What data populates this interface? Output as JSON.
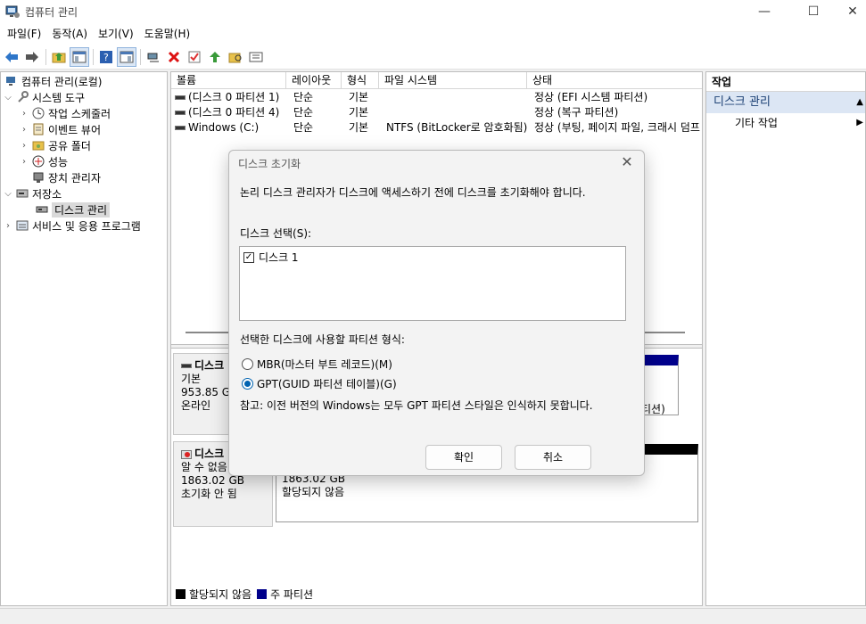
{
  "window": {
    "title": "컴퓨터 관리",
    "minimize": "—",
    "maximize": "☐",
    "close": "✕"
  },
  "menu": [
    "파일(F)",
    "동작(A)",
    "보기(V)",
    "도움말(H)"
  ],
  "toolbar": {
    "icons": [
      "back-arrow-icon",
      "forward-arrow-icon",
      "up-folder-icon",
      "show-pane-icon",
      "help-icon",
      "properties-pane-icon",
      "connect-icon",
      "delete-icon",
      "check-icon",
      "up-arrow-icon",
      "search-folder-icon",
      "list-icon"
    ]
  },
  "tree": {
    "root": "컴퓨터 관리(로컬)",
    "system_tools": "시스템 도구",
    "task_scheduler": "작업 스케줄러",
    "event_viewer": "이벤트 뷰어",
    "shared_folders": "공유 폴더",
    "performance": "성능",
    "device_manager": "장치 관리자",
    "storage": "저장소",
    "disk_management": "디스크 관리",
    "services_apps": "서비스 및 응용 프로그램"
  },
  "volumes": {
    "headers": [
      "볼륨",
      "레이아웃",
      "형식",
      "파일 시스템",
      "상태"
    ],
    "rows": [
      {
        "name": "(디스크 0 파티션 1)",
        "layout": "단순",
        "type": "기본",
        "fs": "",
        "status": "정상 (EFI 시스템 파티션)"
      },
      {
        "name": "(디스크 0 파티션 4)",
        "layout": "단순",
        "type": "기본",
        "fs": "",
        "status": "정상 (복구 파티션)"
      },
      {
        "name": "Windows (C:)",
        "layout": "단순",
        "type": "기본",
        "fs": "NTFS (BitLocker로 암호화됨)",
        "status": "정상 (부팅, 페이지 파일, 크래시 덤프"
      }
    ]
  },
  "disks": {
    "disk0": {
      "name": "디스크",
      "type": "기본",
      "size": "953.85 GB",
      "state": "온라인",
      "partial_status": "티션)"
    },
    "disk1": {
      "name": "디스크",
      "type": "알 수 없음",
      "size": "1863.02 GB",
      "state": "초기화 안 됨",
      "part_size": "1863.02 GB",
      "part_state": "할당되지 않음"
    }
  },
  "legend": {
    "unallocated": "할당되지 않음",
    "primary": "주 파티션",
    "unallocated_color": "#000000",
    "primary_color": "#00008b"
  },
  "actions": {
    "title": "작업",
    "section": "디스크 관리",
    "more": "기타 작업"
  },
  "dialog": {
    "title": "디스크 초기화",
    "intro": "논리 디스크 관리자가 디스크에 액세스하기 전에 디스크를 초기화해야 합니다.",
    "select_label": "디스크 선택(S):",
    "disks": [
      {
        "label": "디스크 1",
        "checked": true
      }
    ],
    "partition_label": "선택한 디스크에 사용할 파티션 형식:",
    "mbr": "MBR(마스터 부트 레코드)(M)",
    "gpt": "GPT(GUID 파티션 테이블)(G)",
    "note": "참고: 이전 버전의 Windows는 모두 GPT 파티션 스타일은 인식하지 못합니다.",
    "ok": "확인",
    "cancel": "취소"
  }
}
